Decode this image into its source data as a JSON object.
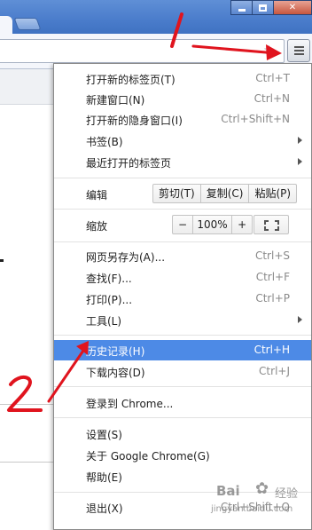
{
  "window": {
    "controls": [
      "minimize-icon",
      "maximize-icon",
      "close-icon"
    ],
    "close_glyph": "✕"
  },
  "toolbar": {
    "star_icon": "☆",
    "menu_icon": "hamburger-menu-icon"
  },
  "menu": {
    "groups": [
      [
        {
          "label": "打开新的标签页(T)",
          "shortcut": "Ctrl+T"
        },
        {
          "label": "新建窗口(N)",
          "shortcut": "Ctrl+N"
        },
        {
          "label": "打开新的隐身窗口(I)",
          "shortcut": "Ctrl+Shift+N"
        },
        {
          "label": "书签(B)",
          "submenu": true
        },
        {
          "label": "最近打开的标签页",
          "submenu": true
        }
      ]
    ],
    "edit": {
      "label": "编辑",
      "cut": "剪切(T)",
      "copy": "复制(C)",
      "paste": "粘贴(P)"
    },
    "zoom": {
      "label": "缩放",
      "minus": "−",
      "value": "100%",
      "plus": "+"
    },
    "save_as": {
      "label": "网页另存为(A)...",
      "shortcut": "Ctrl+S"
    },
    "find": {
      "label": "查找(F)...",
      "shortcut": "Ctrl+F"
    },
    "print": {
      "label": "打印(P)...",
      "shortcut": "Ctrl+P"
    },
    "tools": {
      "label": "工具(L)"
    },
    "history": {
      "label": "历史记录(H)",
      "shortcut": "Ctrl+H",
      "highlighted": true
    },
    "downloads": {
      "label": "下载内容(D)",
      "shortcut": "Ctrl+J"
    },
    "signin": {
      "label": "登录到 Chrome..."
    },
    "settings": {
      "label": "设置(S)"
    },
    "about": {
      "label": "关于 Google Chrome(G)"
    },
    "help": {
      "label": "帮助(E)"
    },
    "exit": {
      "label": "退出(X)",
      "shortcut": "Ctrl+Shift+Q"
    }
  },
  "annotations": {
    "step1": "1",
    "step2": "2",
    "arrow_color": "#e0141e"
  },
  "watermark": {
    "brand": "Bai",
    "brand2": "经验",
    "url": "jingyan.baidu.com"
  }
}
